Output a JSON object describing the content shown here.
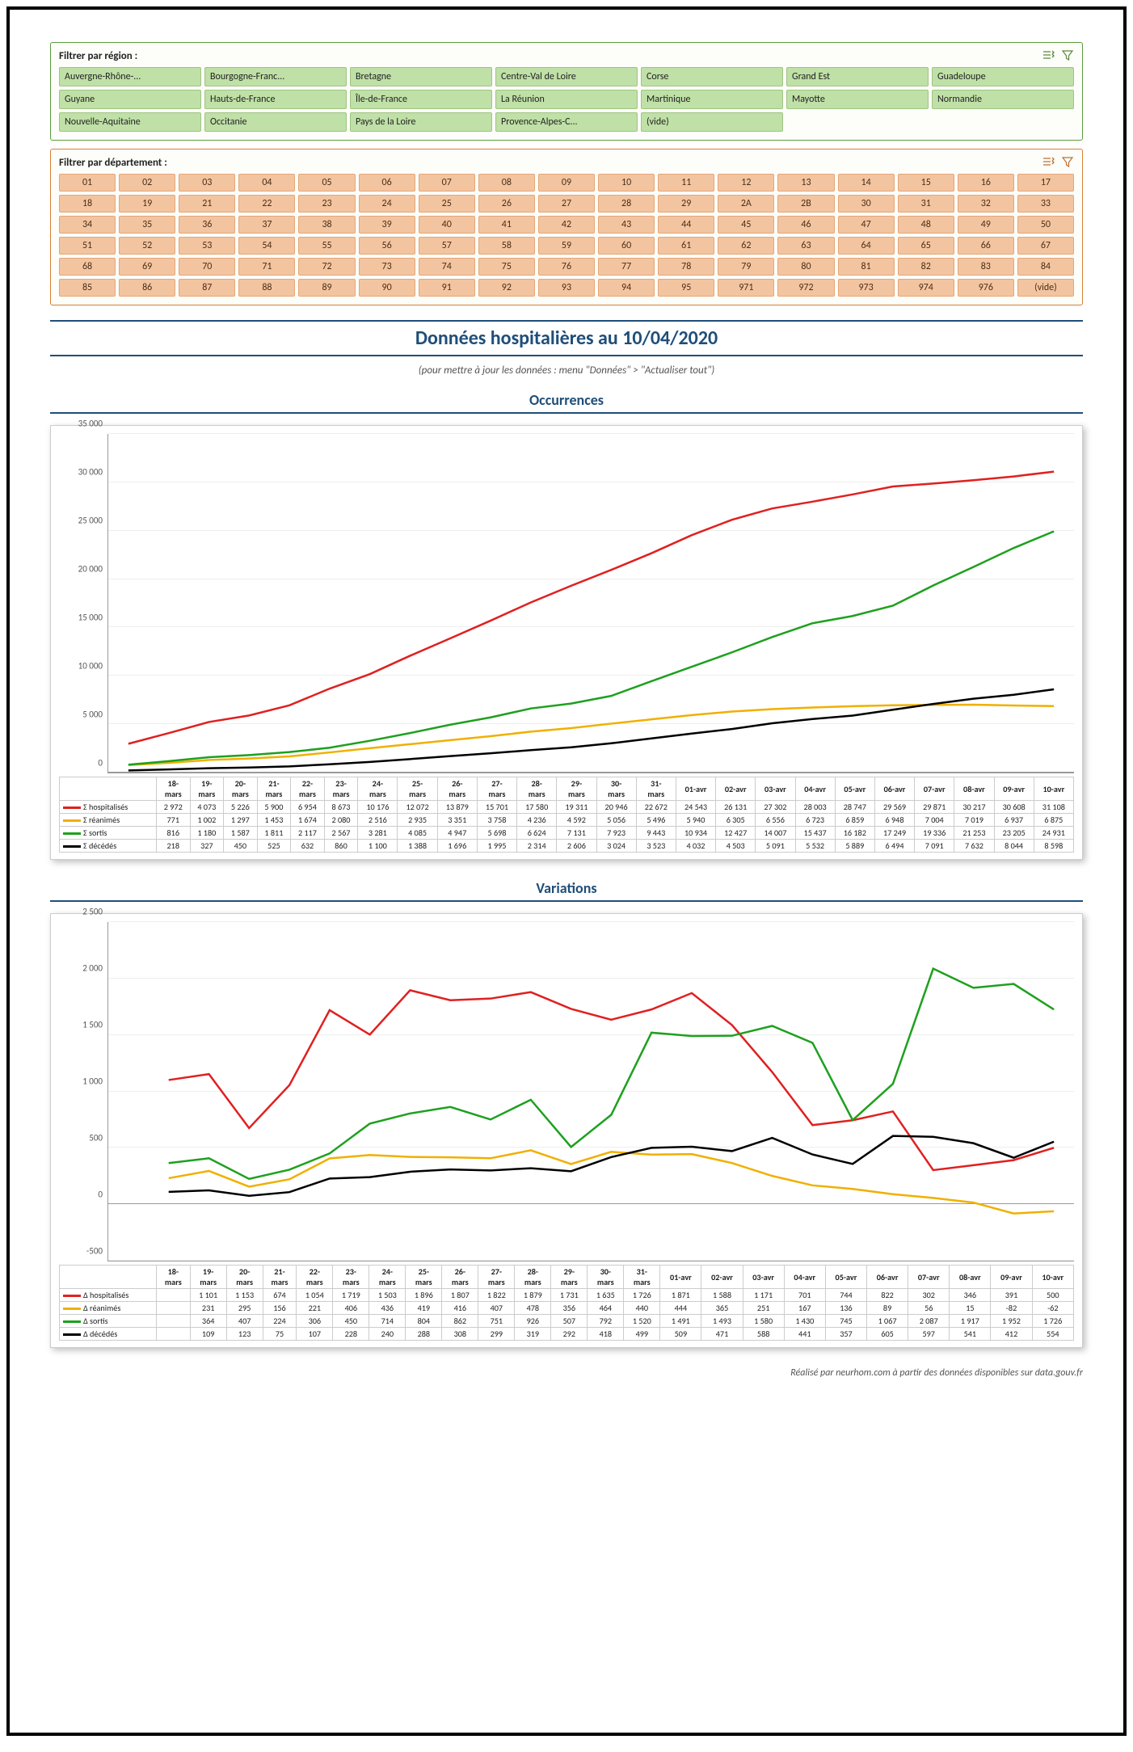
{
  "filters": {
    "region_label": "Filtrer par région :",
    "regions": [
      "Auvergne-Rhône-...",
      "Bourgogne-Franc...",
      "Bretagne",
      "Centre-Val de Loire",
      "Corse",
      "Grand Est",
      "Guadeloupe",
      "Guyane",
      "Hauts-de-France",
      "Île-de-France",
      "La Réunion",
      "Martinique",
      "Mayotte",
      "Normandie",
      "Nouvelle-Aquitaine",
      "Occitanie",
      "Pays de la Loire",
      "Provence-Alpes-C...",
      "(vide)"
    ],
    "dept_label": "Filtrer par département :",
    "depts": [
      "01",
      "02",
      "03",
      "04",
      "05",
      "06",
      "07",
      "08",
      "09",
      "10",
      "11",
      "12",
      "13",
      "14",
      "15",
      "16",
      "17",
      "18",
      "19",
      "21",
      "22",
      "23",
      "24",
      "25",
      "26",
      "27",
      "28",
      "29",
      "2A",
      "2B",
      "30",
      "31",
      "32",
      "33",
      "34",
      "35",
      "36",
      "37",
      "38",
      "39",
      "40",
      "41",
      "42",
      "43",
      "44",
      "45",
      "46",
      "47",
      "48",
      "49",
      "50",
      "51",
      "52",
      "53",
      "54",
      "55",
      "56",
      "57",
      "58",
      "59",
      "60",
      "61",
      "62",
      "63",
      "64",
      "65",
      "66",
      "67",
      "68",
      "69",
      "70",
      "71",
      "72",
      "73",
      "74",
      "75",
      "76",
      "77",
      "78",
      "79",
      "80",
      "81",
      "82",
      "83",
      "84",
      "85",
      "86",
      "87",
      "88",
      "89",
      "90",
      "91",
      "92",
      "93",
      "94",
      "95",
      "971",
      "972",
      "973",
      "974",
      "976",
      "(vide)"
    ]
  },
  "header": {
    "title": "Données hospitalières au 10/04/2020",
    "subtitle": "(pour mettre à jour les données : menu \"Données\" > \"Actualiser tout\")"
  },
  "section_titles": {
    "occurrences": "Occurrences",
    "variations": "Variations"
  },
  "series_colors": {
    "hospitalises": "#e02020",
    "reanimes": "#f0b000",
    "sortis": "#1ea01e",
    "decedes": "#000000"
  },
  "legend_labels": {
    "sigma_hosp": "Σ hospitalisés",
    "sigma_rea": "Σ réanimés",
    "sigma_sortis": "Σ sortis",
    "sigma_dec": "Σ décédés",
    "delta_hosp": "Δ hospitalisés",
    "delta_rea": "Δ réanimés",
    "delta_sortis": "Δ sortis",
    "delta_dec": "Δ décédés"
  },
  "footer": "Réalisé par neurhom.com à partir des données disponibles sur data.gouv.fr",
  "chart_data": [
    {
      "type": "line",
      "title": "Occurrences",
      "xlabel": "",
      "ylabel": "",
      "ylim": [
        0,
        35000
      ],
      "y_ticks": [
        0,
        5000,
        10000,
        15000,
        20000,
        25000,
        30000,
        35000
      ],
      "y_tick_labels": [
        "0",
        "5 000",
        "10 000",
        "15 000",
        "20 000",
        "25 000",
        "30 000",
        "35 000"
      ],
      "categories": [
        "18-mars",
        "19-mars",
        "20-mars",
        "21-mars",
        "22-mars",
        "23-mars",
        "24-mars",
        "25-mars",
        "26-mars",
        "27-mars",
        "28-mars",
        "29-mars",
        "30-mars",
        "31-mars",
        "01-avr",
        "02-avr",
        "03-avr",
        "04-avr",
        "05-avr",
        "06-avr",
        "07-avr",
        "08-avr",
        "09-avr",
        "10-avr"
      ],
      "series": [
        {
          "name": "Σ hospitalisés",
          "color": "#e02020",
          "values": [
            2972,
            4073,
            5226,
            5900,
            6954,
            8673,
            10176,
            12072,
            13879,
            15701,
            17580,
            19311,
            20946,
            22672,
            24543,
            26131,
            27302,
            28003,
            28747,
            29569,
            29871,
            30217,
            30608,
            31108
          ]
        },
        {
          "name": "Σ réanimés",
          "color": "#f0b000",
          "values": [
            771,
            1002,
            1297,
            1453,
            1674,
            2080,
            2516,
            2935,
            3351,
            3758,
            4236,
            4592,
            5056,
            5496,
            5940,
            6305,
            6556,
            6723,
            6859,
            6948,
            7004,
            7019,
            6937,
            6875
          ]
        },
        {
          "name": "Σ sortis",
          "color": "#1ea01e",
          "values": [
            816,
            1180,
            1587,
            1811,
            2117,
            2567,
            3281,
            4085,
            4947,
            5698,
            6624,
            7131,
            7923,
            9443,
            10934,
            12427,
            14007,
            15437,
            16182,
            17249,
            19336,
            21253,
            23205,
            24931
          ]
        },
        {
          "name": "Σ décédés",
          "color": "#000000",
          "values": [
            218,
            327,
            450,
            525,
            632,
            860,
            1100,
            1388,
            1696,
            1995,
            2314,
            2606,
            3024,
            3523,
            4032,
            4503,
            5091,
            5532,
            5889,
            6494,
            7091,
            7632,
            8044,
            8598
          ]
        }
      ]
    },
    {
      "type": "line",
      "title": "Variations",
      "xlabel": "",
      "ylabel": "",
      "ylim": [
        -500,
        2500
      ],
      "y_ticks": [
        -500,
        0,
        500,
        1000,
        1500,
        2000,
        2500
      ],
      "y_tick_labels": [
        "-500",
        "0",
        "500",
        "1 000",
        "1 500",
        "2 000",
        "2 500"
      ],
      "categories": [
        "18-mars",
        "19-mars",
        "20-mars",
        "21-mars",
        "22-mars",
        "23-mars",
        "24-mars",
        "25-mars",
        "26-mars",
        "27-mars",
        "28-mars",
        "29-mars",
        "30-mars",
        "31-mars",
        "01-avr",
        "02-avr",
        "03-avr",
        "04-avr",
        "05-avr",
        "06-avr",
        "07-avr",
        "08-avr",
        "09-avr",
        "10-avr"
      ],
      "series": [
        {
          "name": "Δ hospitalisés",
          "color": "#e02020",
          "values": [
            null,
            1101,
            1153,
            674,
            1054,
            1719,
            1503,
            1896,
            1807,
            1822,
            1879,
            1731,
            1635,
            1726,
            1871,
            1588,
            1171,
            701,
            744,
            822,
            302,
            346,
            391,
            500
          ]
        },
        {
          "name": "Δ réanimés",
          "color": "#f0b000",
          "values": [
            null,
            231,
            295,
            156,
            221,
            406,
            436,
            419,
            416,
            407,
            478,
            356,
            464,
            440,
            444,
            365,
            251,
            167,
            136,
            89,
            56,
            15,
            -82,
            -62
          ]
        },
        {
          "name": "Δ sortis",
          "color": "#1ea01e",
          "values": [
            null,
            364,
            407,
            224,
            306,
            450,
            714,
            804,
            862,
            751,
            926,
            507,
            792,
            1520,
            1491,
            1493,
            1580,
            1430,
            745,
            1067,
            2087,
            1917,
            1952,
            1726
          ]
        },
        {
          "name": "Δ décédés",
          "color": "#000000",
          "values": [
            null,
            109,
            123,
            75,
            107,
            228,
            240,
            288,
            308,
            299,
            319,
            292,
            418,
            499,
            509,
            471,
            588,
            441,
            357,
            605,
            597,
            541,
            412,
            554
          ]
        }
      ]
    }
  ]
}
